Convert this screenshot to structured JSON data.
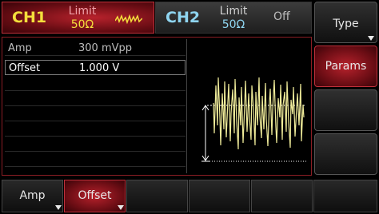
{
  "channels": {
    "ch1": {
      "name": "CH1",
      "limit_label": "Limit",
      "impedance": "50Ω",
      "waveform_icon": "noise-wave-icon",
      "active": true
    },
    "ch2": {
      "name": "CH2",
      "limit_label": "Limit",
      "impedance": "50Ω",
      "state": "Off",
      "active": false
    }
  },
  "params": {
    "rows": [
      {
        "key": "Amp",
        "value": "300 mVpp",
        "selected": false
      },
      {
        "key": "Offset",
        "value": "1.000 V",
        "selected": true
      }
    ]
  },
  "side_menu": [
    {
      "label": "Type",
      "has_dropdown": true,
      "active": false
    },
    {
      "label": "Params",
      "has_dropdown": false,
      "active": true
    },
    {
      "label": "",
      "has_dropdown": false,
      "active": false
    },
    {
      "label": "",
      "has_dropdown": false,
      "active": false
    }
  ],
  "bottom_menu": [
    {
      "label": "Amp",
      "has_dropdown": true,
      "active": false
    },
    {
      "label": "Offset",
      "has_dropdown": true,
      "active": true
    },
    {
      "label": "",
      "active": false
    },
    {
      "label": "",
      "active": false
    },
    {
      "label": "",
      "active": false
    },
    {
      "label": "",
      "active": false
    }
  ],
  "colors": {
    "accent_red": "#b8222c",
    "ch1_yellow": "#f4df3c",
    "ch2_cyan": "#8fd5f0",
    "trace": "#f0ec9a"
  }
}
